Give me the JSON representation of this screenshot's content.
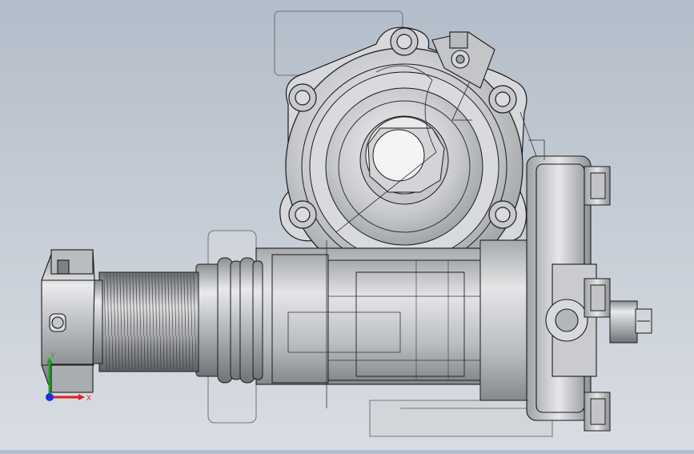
{
  "viewport": {
    "background_top": "#b3bdc9",
    "background_bottom": "#d9dde3",
    "model_color": "#d3d5d8",
    "edge_color": "#1a1a1a"
  },
  "triad": {
    "x_label": "X",
    "y_label": "Y",
    "x_color": "#e0201a",
    "y_color": "#1ea21e",
    "z_color": "#1d2fd6"
  }
}
